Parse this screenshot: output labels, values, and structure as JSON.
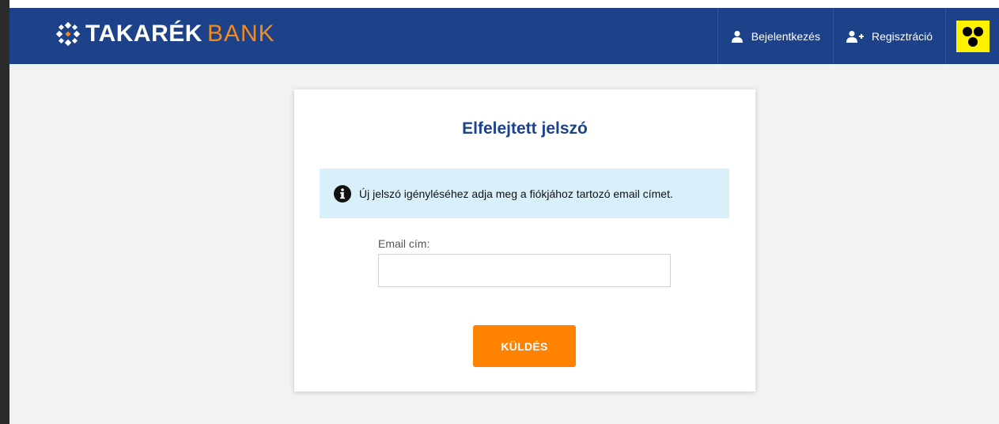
{
  "header": {
    "logo_prefix": "TAKARÉK",
    "logo_suffix": "BANK",
    "login_label": "Bejelentkezés",
    "register_label": "Regisztráció",
    "accessibility_icon": "low-vision-icon"
  },
  "card": {
    "title": "Elfelejtett jelszó",
    "info_icon": "info-icon",
    "info_text": "Új jelszó igényléséhez adja meg a fiókjához tartozó email címet.",
    "email_label": "Email cím:",
    "email_value": "",
    "email_placeholder": "",
    "submit_label": "KÜLDÉS"
  },
  "colors": {
    "navbar": "#1d4289",
    "accent": "#ff8200",
    "info_bg": "#d9f0fa",
    "accessibility_bg": "#fff200"
  }
}
